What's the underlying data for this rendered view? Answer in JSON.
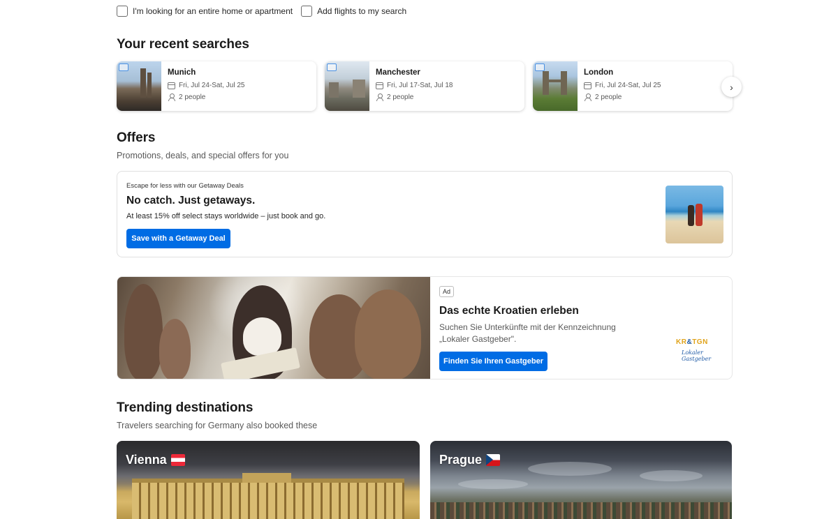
{
  "filters": {
    "entire_home": "I'm looking for an entire home or apartment",
    "add_flights": "Add flights to my search"
  },
  "recent": {
    "title": "Your recent searches",
    "items": [
      {
        "city": "Munich",
        "dates": "Fri, Jul 24-Sat, Jul 25",
        "people": "2 people"
      },
      {
        "city": "Manchester",
        "dates": "Fri, Jul 17-Sat, Jul 18",
        "people": "2 people"
      },
      {
        "city": "London",
        "dates": "Fri, Jul 24-Sat, Jul 25",
        "people": "2 people"
      }
    ],
    "next_glyph": "›"
  },
  "offers": {
    "title": "Offers",
    "subtitle": "Promotions, deals, and special offers for you",
    "deal": {
      "eyebrow": "Escape for less with our Getaway Deals",
      "headline": "No catch. Just getaways.",
      "description": "At least 15% off select stays worldwide – just book and go.",
      "button": "Save with a Getaway Deal"
    }
  },
  "ad": {
    "badge": "Ad",
    "headline": "Das echte Kroatien erleben",
    "description": "Suchen Sie Unterkünfte mit der Kennzeichnung „Lokaler Gastgeber\".",
    "button": "Finden Sie Ihren Gastgeber",
    "logo_text_a": "KR",
    "logo_text_b": "&",
    "logo_text_c": "TGN",
    "logo_script": "Lokaler Gastgeber"
  },
  "trending": {
    "title": "Trending destinations",
    "subtitle": "Travelers searching for Germany also booked these",
    "items": [
      {
        "name": "Vienna",
        "flag": "austria-flag"
      },
      {
        "name": "Prague",
        "flag": "czech-flag"
      }
    ]
  },
  "colors": {
    "primary_button": "#006ce4",
    "bed_icon": "#4a90e2"
  }
}
